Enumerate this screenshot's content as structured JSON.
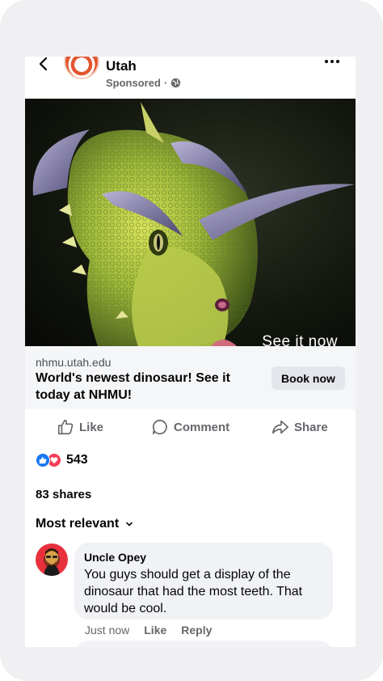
{
  "post": {
    "page_name": "Utah",
    "sponsored_label": "Sponsored",
    "separator": "·",
    "media_overlay_text": "See it now",
    "link_domain": "nhmu.utah.edu",
    "link_title": "World's newest dinosaur! See it today at NHMU!",
    "cta_label": "Book now"
  },
  "actions": {
    "like": "Like",
    "comment": "Comment",
    "share": "Share"
  },
  "stats": {
    "reaction_count": "543",
    "shares": "83 shares"
  },
  "comments": {
    "sort_label": "Most relevant",
    "items": [
      {
        "author": "Uncle Opey",
        "text": "You guys should get a display of the dinosaur that had the most teeth. That would be cool.",
        "time": "Just now",
        "like": "Like",
        "reply": "Reply"
      }
    ]
  },
  "icons": {
    "back": "chevron-left-icon",
    "more": "more-dots-icon",
    "audience": "globe-icon",
    "like_reaction": "thumbs-up-icon",
    "love_reaction": "heart-icon"
  },
  "colors": {
    "accent_blue": "#1877f2",
    "love_red": "#f33e58",
    "muted_text": "#65676b",
    "bubble_bg": "#f0f2f5",
    "page_avatar": "#e2562f"
  }
}
